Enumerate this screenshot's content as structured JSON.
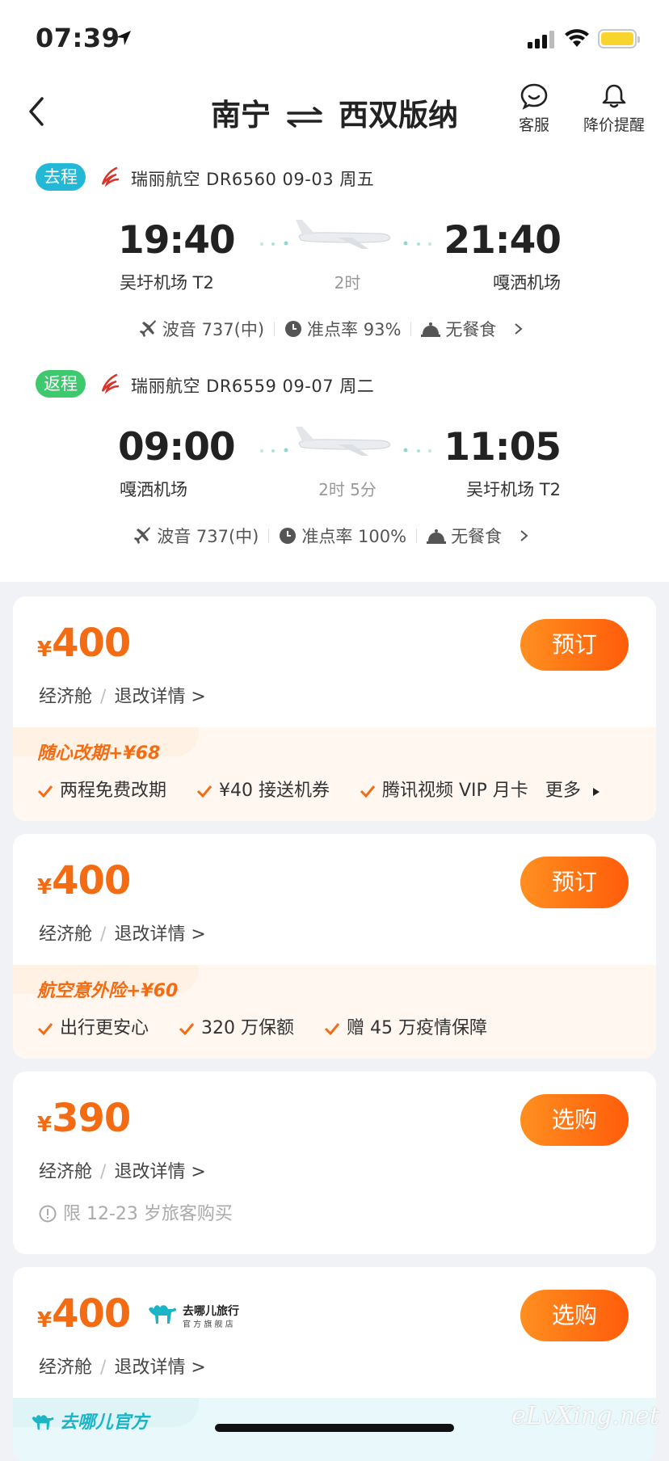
{
  "status_bar": {
    "time": "07:39"
  },
  "header": {
    "from_city": "南宁",
    "to_city": "西双版纳",
    "service_label": "客服",
    "price_alert_label": "降价提醒"
  },
  "outbound": {
    "tag": "去程",
    "info": "瑞丽航空 DR6560  09-03 周五",
    "dep_time": "19:40",
    "dep_airport": "吴圩机场 T2",
    "arr_time": "21:40",
    "arr_airport": "嘎洒机场",
    "duration": "2时",
    "aircraft": "波音 737(中)",
    "ontime": "准点率 93%",
    "meal": "无餐食",
    "tag_color": "#22b8d6"
  },
  "return": {
    "tag": "返程",
    "info": "瑞丽航空 DR6559  09-07 周二",
    "dep_time": "09:00",
    "dep_airport": "嘎洒机场",
    "arr_time": "11:05",
    "arr_airport": "吴圩机场 T2",
    "duration": "2时 5分",
    "aircraft": "波音 737(中)",
    "ontime": "准点率 100%",
    "meal": "无餐食",
    "tag_color": "#3ec96e"
  },
  "offers": [
    {
      "currency": "¥",
      "price": "400",
      "cabin": "经济舱",
      "sep": "/",
      "rules": "退改详情 >",
      "button": "预订",
      "promo_title": "随心改期+¥68",
      "promo_items": [
        "两程免费改期",
        "¥40 接送机券",
        "腾讯视频 VIP 月卡"
      ],
      "promo_more": "更多"
    },
    {
      "currency": "¥",
      "price": "400",
      "cabin": "经济舱",
      "sep": "/",
      "rules": "退改详情 >",
      "button": "预订",
      "promo_title": "航空意外险+¥60",
      "promo_items": [
        "出行更安心",
        "320 万保额",
        "赠 45 万疫情保障"
      ]
    },
    {
      "currency": "¥",
      "price": "390",
      "cabin": "经济舱",
      "sep": "/",
      "rules": "退改详情 >",
      "button": "选购",
      "note": "限 12-23 岁旅客购买"
    },
    {
      "currency": "¥",
      "price": "400",
      "cabin": "经济舱",
      "sep": "/",
      "rules": "退改详情 >",
      "button": "选购",
      "store_name": "去哪儿旅行",
      "store_sub": "官 方 旗 舰 店",
      "promo_title": "去哪儿官方"
    }
  ],
  "watermark": "eLvXing.net",
  "colors": {
    "accent": "#f36b12",
    "button": "#ff6a10"
  }
}
